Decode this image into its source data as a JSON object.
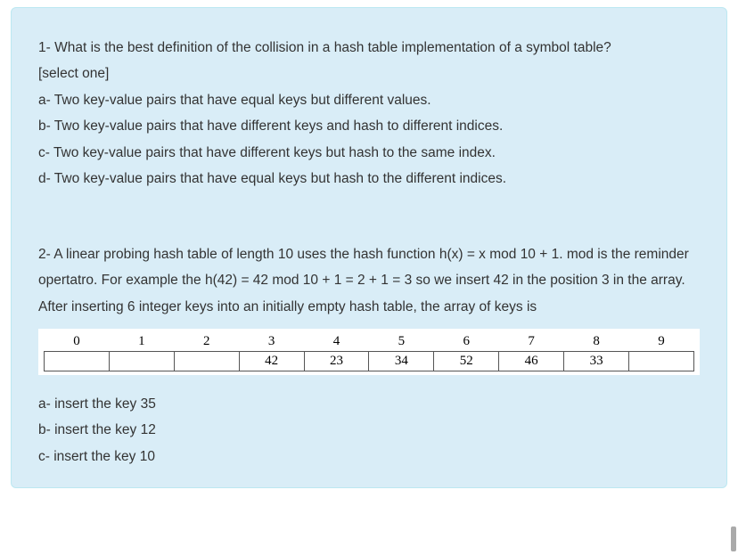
{
  "q1": {
    "prompt": "1- What is the best definition of the collision in a hash table implementation of a symbol table?",
    "instruction": "[select one]",
    "a": "a- Two key-value pairs that have equal keys but different values.",
    "b": "b- Two key-value pairs that have different keys and hash to different indices.",
    "c": "c- Two key-value pairs that have different keys but hash to the same index.",
    "d": "d- Two key-value pairs that have equal keys but hash to the different indices."
  },
  "q2": {
    "line1": "2- A linear probing hash table of length 10 uses the hash function h(x) = x mod 10 + 1.  mod is the reminder opertatro. For example the h(42) = 42 mod 10 + 1 = 2 + 1 = 3 so we insert 42 in the position 3 in the array.",
    "line2": "After inserting 6 integer keys into an initially empty hash table, the array of keys is",
    "table": {
      "headers": [
        "0",
        "1",
        "2",
        "3",
        "4",
        "5",
        "6",
        "7",
        "8",
        "9"
      ],
      "values": [
        "",
        "",
        "",
        "42",
        "23",
        "34",
        "52",
        "46",
        "33",
        ""
      ]
    },
    "a": "a- insert the key 35",
    "b": "b- insert the key 12",
    "c": "c- insert the key 10"
  },
  "chart_data": {
    "type": "table",
    "title": "Hash table array contents after inserting 6 keys",
    "categories": [
      "0",
      "1",
      "2",
      "3",
      "4",
      "5",
      "6",
      "7",
      "8",
      "9"
    ],
    "values": [
      null,
      null,
      null,
      42,
      23,
      34,
      52,
      46,
      33,
      null
    ]
  }
}
